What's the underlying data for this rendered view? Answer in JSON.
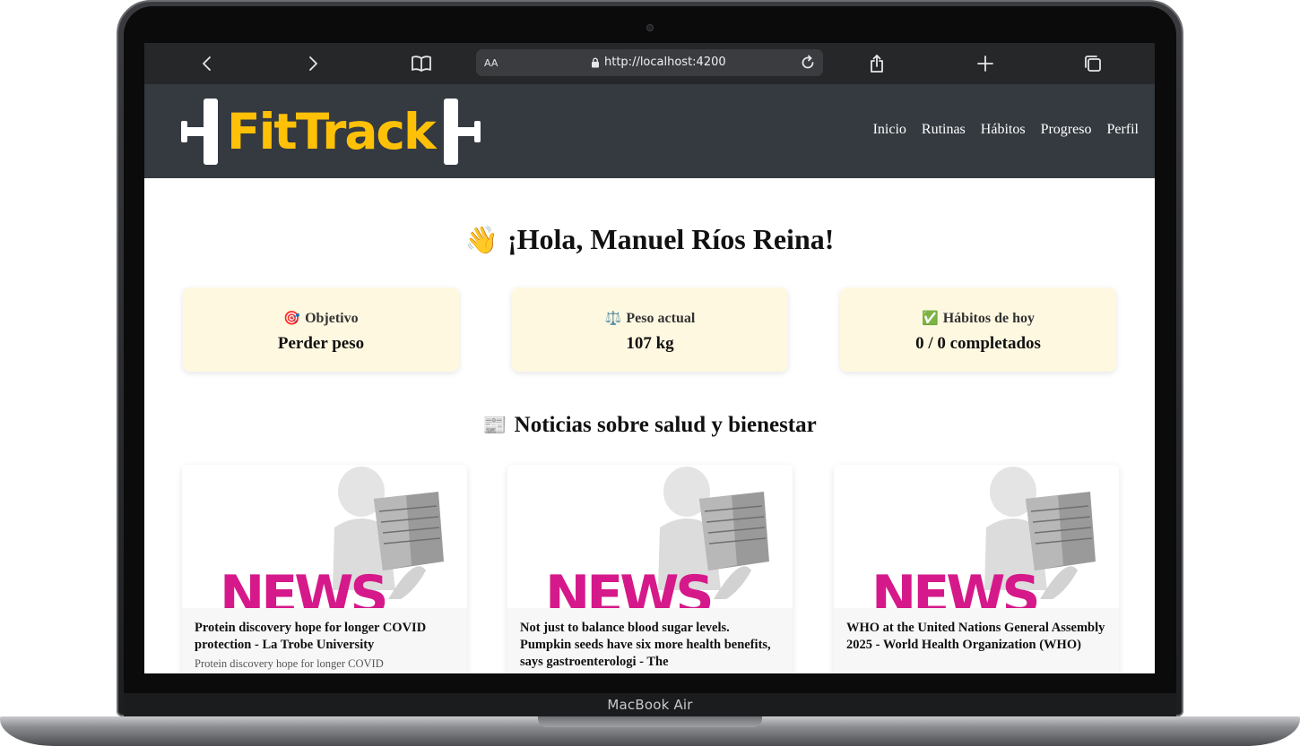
{
  "device": {
    "label": "MacBook Air"
  },
  "browser": {
    "text_size_label": "AA",
    "url": "http://localhost:4200"
  },
  "header": {
    "logo_text": "FitTrack",
    "nav": [
      "Inicio",
      "Rutinas",
      "Hábitos",
      "Progreso",
      "Perfil"
    ]
  },
  "greeting": {
    "emoji": "👋",
    "text": "¡Hola, Manuel Ríos Reina!"
  },
  "stats": [
    {
      "icon": "🎯",
      "label": "Objetivo",
      "value": "Perder peso"
    },
    {
      "icon": "⚖️",
      "label": "Peso actual",
      "value": "107 kg"
    },
    {
      "icon": "✅",
      "label": "Hábitos de hoy",
      "value": "0 / 0 completados"
    }
  ],
  "news": {
    "icon": "📰",
    "title": "Noticias sobre salud y bienestar",
    "image_word": "NEWS",
    "items": [
      {
        "headline": "Protein discovery hope for longer COVID protection - La Trobe University",
        "description": "Protein discovery hope for longer COVID"
      },
      {
        "headline": "Not just to balance blood sugar levels. Pumpkin seeds have six more health benefits, says gastroenterologi - The",
        "description": ""
      },
      {
        "headline": "WHO at the United Nations General Assembly 2025 - World Health Organization (WHO)",
        "description": ""
      }
    ]
  },
  "colors": {
    "header_bg": "#343a40",
    "accent": "#ffc107",
    "card_bg": "#fff8e1",
    "news_magenta": "#d6198a"
  }
}
